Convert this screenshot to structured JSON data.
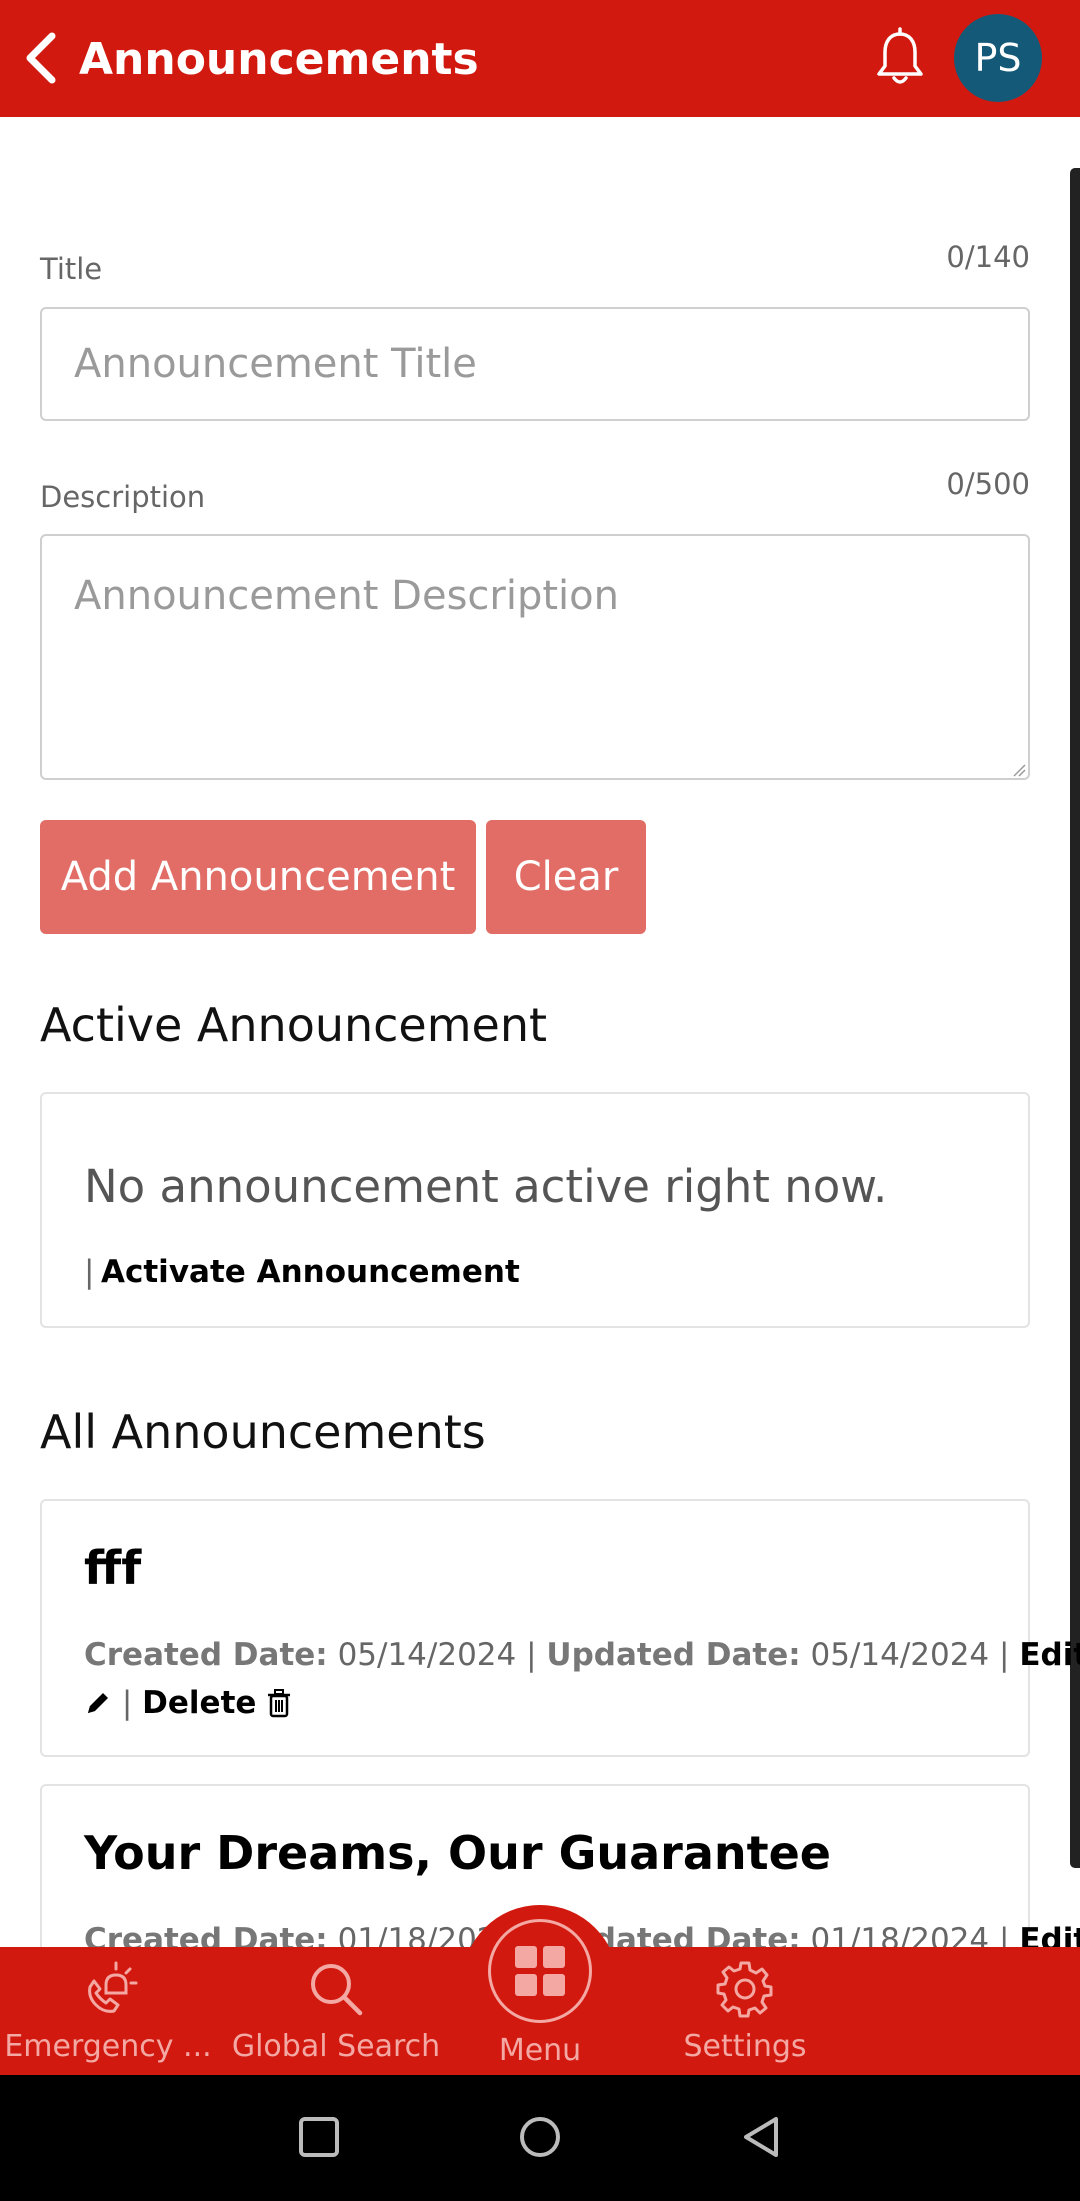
{
  "header": {
    "title": "Announcements",
    "avatar_initials": "PS",
    "color": "#d2190f"
  },
  "form": {
    "title_label": "Title",
    "title_counter": "0/140",
    "title_placeholder": "Announcement Title",
    "description_label": "Description",
    "description_counter": "0/500",
    "description_placeholder": "Announcement Description",
    "add_button": "Add Announcement",
    "clear_button": "Clear"
  },
  "active": {
    "heading": "Active Announcement",
    "empty_text": "No announcement active right now.",
    "separator": "|",
    "activate_link": "Activate Announcement"
  },
  "all": {
    "heading": "All Announcements",
    "items": [
      {
        "title": "fff",
        "created_label": "Created Date:",
        "created": "05/14/2024",
        "updated_label": "Updated Date:",
        "updated": "05/14/2024",
        "edit": "Edit",
        "delete": "Delete"
      },
      {
        "title": "Your Dreams, Our Guarantee",
        "created_label": "Created Date:",
        "created": "01/18/2024",
        "updated_label": "Updated Date:",
        "updated": "01/18/2024",
        "edit": "Edit"
      }
    ]
  },
  "bottom_nav": [
    {
      "label": "Emergency ...",
      "icon": "emergency-icon"
    },
    {
      "label": "Global Search",
      "icon": "search-icon"
    },
    {
      "label": "Menu",
      "icon": "grid-icon"
    },
    {
      "label": "Settings",
      "icon": "gear-icon"
    }
  ]
}
